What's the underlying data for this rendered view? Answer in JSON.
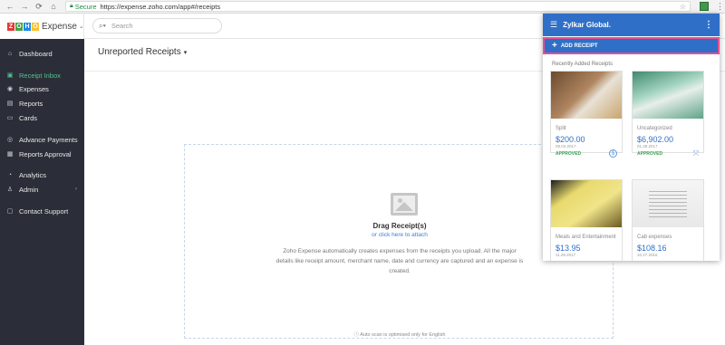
{
  "browser": {
    "secure_label": "Secure",
    "url": "https://expense.zoho.com/app#/receipts"
  },
  "header": {
    "brand_letters": [
      "Z",
      "O",
      "H",
      "O"
    ],
    "brand_letter_colors": [
      "#e53935",
      "#43a047",
      "#1e88e5",
      "#fbc02d"
    ],
    "brand_name": "Expense",
    "search_placeholder": "Search"
  },
  "sidebar": {
    "items": [
      {
        "label": "Dashboard",
        "icon": "home-icon"
      },
      {
        "label": "Receipt Inbox",
        "icon": "inbox-icon",
        "active": true
      },
      {
        "label": "Expenses",
        "icon": "expenses-icon"
      },
      {
        "label": "Reports",
        "icon": "reports-icon"
      },
      {
        "label": "Cards",
        "icon": "card-icon"
      },
      {
        "label": "Advance Payments",
        "icon": "advance-icon"
      },
      {
        "label": "Reports Approval",
        "icon": "approval-icon"
      },
      {
        "label": "Analytics",
        "icon": "analytics-icon"
      },
      {
        "label": "Admin",
        "icon": "admin-icon"
      },
      {
        "label": "Contact Support",
        "icon": "support-icon"
      }
    ]
  },
  "main": {
    "title": "Unreported Receipts",
    "drag_title": "Drag Receipt(s)",
    "drag_link": "or click here to attach",
    "drag_desc": "Zoho Expense automatically creates expenses from the receipts you upload. All the major details like receipt amount, merchant name, date and currency are captured and an expense is created.",
    "auto_scan": "Auto scan is optimised only for English"
  },
  "panel": {
    "org": "Zylkar Global.",
    "add_receipt": "ADD RECEIPT",
    "recent_label": "Recently Added Receipts",
    "cards": [
      {
        "category": "Split",
        "amount": "$200.00",
        "date": "09.04.2017",
        "status": "APPROVED",
        "action": "dollar-icon"
      },
      {
        "category": "Uncategorized",
        "amount": "$6,902.00",
        "date": "01.28.2017",
        "status": "APPROVED",
        "action": "merge-icon"
      },
      {
        "category": "Meals and Entertainment",
        "amount": "$13.95",
        "date": "11.28.2017",
        "status": "",
        "action": ""
      },
      {
        "category": "Cab expenses",
        "amount": "$108.16",
        "date": "10.27.2016",
        "status": "",
        "action": ""
      }
    ]
  }
}
